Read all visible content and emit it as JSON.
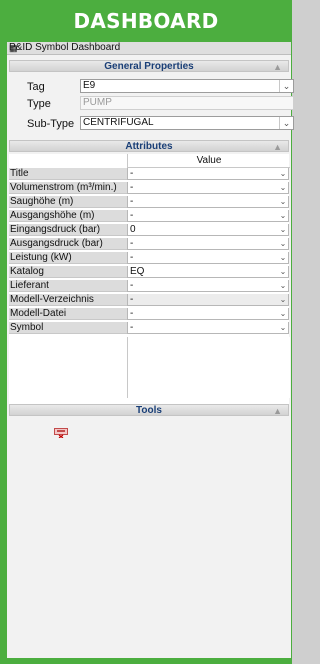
{
  "header": {
    "title": "DASHBOARD"
  },
  "panel": {
    "title": "P&ID Symbol Dashboard",
    "pin_icon": "pin-icon"
  },
  "general": {
    "title": "General Properties",
    "tag_label": "Tag",
    "tag_value": "E9",
    "type_label": "Type",
    "type_value": "PUMP",
    "subtype_label": "Sub-Type",
    "subtype_value": "CENTRIFUGAL"
  },
  "attributes": {
    "title": "Attributes",
    "value_header": "Value",
    "rows": [
      {
        "name": "Title",
        "value": "-"
      },
      {
        "name": "Volumenstrom (m³/min.)",
        "value": "-"
      },
      {
        "name": "Saughöhe (m)",
        "value": "-"
      },
      {
        "name": "Ausgangshöhe (m)",
        "value": "-"
      },
      {
        "name": "Eingangsdruck (bar)",
        "value": "0"
      },
      {
        "name": "Ausgangsdruck (bar)",
        "value": "-"
      },
      {
        "name": "Leistung (kW)",
        "value": "-"
      },
      {
        "name": "Katalog",
        "value": "EQ"
      },
      {
        "name": "Lieferant",
        "value": "-"
      },
      {
        "name": "Modell-Verzeichnis",
        "value": "-"
      },
      {
        "name": "Modell-Datei",
        "value": "-"
      },
      {
        "name": "Symbol",
        "value": "-"
      }
    ]
  },
  "tools": {
    "title": "Tools",
    "icon": "tool-icon"
  }
}
